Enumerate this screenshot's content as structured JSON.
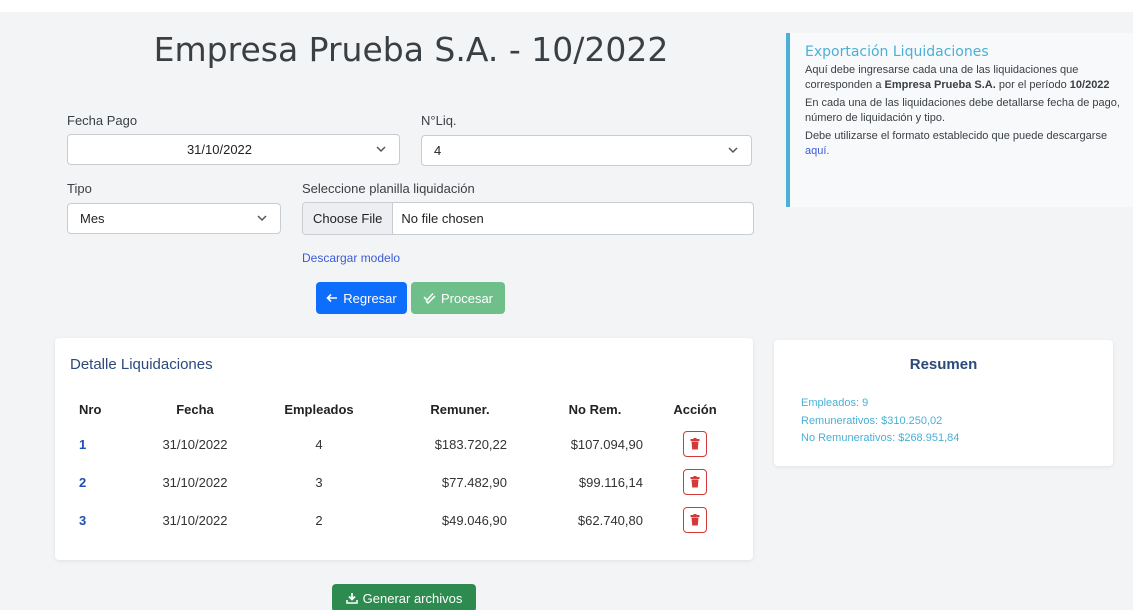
{
  "title": "Empresa Prueba S.A. - 10/2022",
  "form": {
    "fecha_pago_label": "Fecha Pago",
    "fecha_pago_value": "31/10/2022",
    "nliq_label": "N°Liq.",
    "nliq_value": "4",
    "tipo_label": "Tipo",
    "tipo_value": "Mes",
    "planilla_label": "Seleccione planilla liquidación",
    "choose_file": "Choose File",
    "no_file": "No file chosen",
    "descargar_modelo": "Descargar modelo"
  },
  "buttons": {
    "regresar": "Regresar",
    "procesar": "Procesar",
    "generar": "Generar archivos"
  },
  "info": {
    "title": "Exportación Liquidaciones",
    "p1_a": "Aquí debe ingresarse cada una de las liquidaciones que corresponden a ",
    "p1_company": "Empresa Prueba S.A.",
    "p1_b": " por el período ",
    "p1_period": "10/2022",
    "p2": "En cada una de las liquidaciones debe detallarse fecha de pago, número de liquidación y tipo.",
    "p3_a": "Debe utilizarse el formato establecido que puede descargarse ",
    "p3_link": "aquí."
  },
  "detalle": {
    "title": "Detalle Liquidaciones",
    "headers": {
      "nro": "Nro",
      "fecha": "Fecha",
      "empleados": "Empleados",
      "remuner": "Remuner.",
      "norem": "No Rem.",
      "accion": "Acción"
    },
    "rows": [
      {
        "nro": "1",
        "fecha": "31/10/2022",
        "empleados": "4",
        "remuner": "$183.720,22",
        "norem": "$107.094,90"
      },
      {
        "nro": "2",
        "fecha": "31/10/2022",
        "empleados": "3",
        "remuner": "$77.482,90",
        "norem": "$99.116,14"
      },
      {
        "nro": "3",
        "fecha": "31/10/2022",
        "empleados": "2",
        "remuner": "$49.046,90",
        "norem": "$62.740,80"
      }
    ]
  },
  "resumen": {
    "title": "Resumen",
    "empleados": "Empleados: 9",
    "remunerativos": "Remunerativos: $310.250,02",
    "no_remunerativos": "No Remunerativos: $268.951,84"
  },
  "colors": {
    "primary": "#0d6efd",
    "success_light": "#6fbf8a",
    "success": "#2e8b50",
    "info": "#4ab0d6",
    "danger": "#d43a3a"
  }
}
